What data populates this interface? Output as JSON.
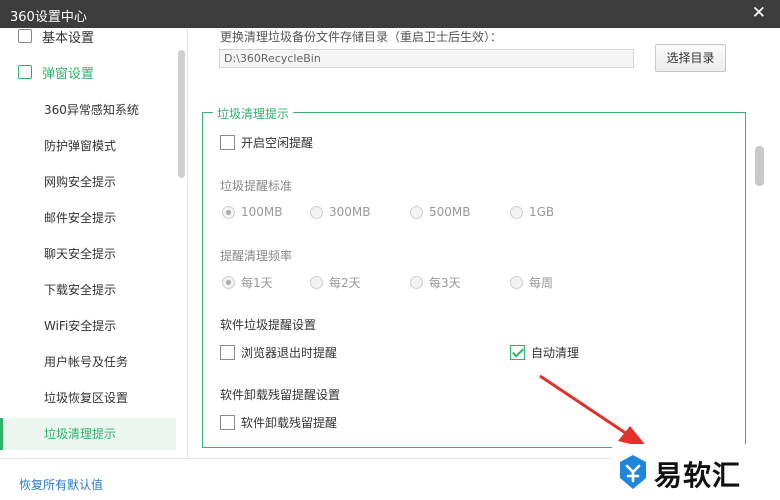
{
  "window": {
    "title": "360设置中心",
    "close_glyph": "✕"
  },
  "sidebar": {
    "groups": [
      {
        "label": "基本设置",
        "icon": "basic-settings-icon"
      },
      {
        "label": "弹窗设置",
        "icon": "popup-settings-icon",
        "active": true
      }
    ],
    "items": [
      {
        "label": "360异常感知系统"
      },
      {
        "label": "防护弹窗模式"
      },
      {
        "label": "网购安全提示"
      },
      {
        "label": "邮件安全提示"
      },
      {
        "label": "聊天安全提示"
      },
      {
        "label": "下载安全提示"
      },
      {
        "label": "WiFi安全提示"
      },
      {
        "label": "用户帐号及任务"
      },
      {
        "label": "垃圾恢复区设置"
      },
      {
        "label": "垃圾清理提示",
        "active": true
      }
    ]
  },
  "backup": {
    "label": "更换清理垃圾备份文件存储目录（重启卫士后生效）：",
    "path": "D:\\360RecycleBin",
    "choose_button": "选择目录"
  },
  "cleanup_tip": {
    "title": "垃圾清理提示",
    "idle_reminder": {
      "label": "开启空闲提醒",
      "checked": false
    },
    "size_standard": {
      "label": "垃圾提醒标准",
      "options": [
        "100MB",
        "300MB",
        "500MB",
        "1GB"
      ],
      "selected": "100MB"
    },
    "frequency": {
      "label": "提醒清理频率",
      "options": [
        "每1天",
        "每2天",
        "每3天",
        "每周"
      ],
      "selected": "每1天"
    },
    "software_reminder": {
      "label": "软件垃圾提醒设置",
      "browser_exit": {
        "label": "浏览器退出时提醒",
        "checked": false
      },
      "auto_clean": {
        "label": "自动清理",
        "checked": true
      }
    },
    "uninstall_reminder": {
      "label": "软件卸载残留提醒设置",
      "item": {
        "label": "软件卸载残留提醒",
        "checked": false
      }
    }
  },
  "footer": {
    "restore_defaults": "恢复所有默认值"
  },
  "watermark": {
    "text": "易软汇"
  },
  "colors": {
    "accent": "#2fb36b",
    "titlebar": "#3c3c3c",
    "link": "#2a7ad1",
    "arrow": "#e0312b"
  }
}
